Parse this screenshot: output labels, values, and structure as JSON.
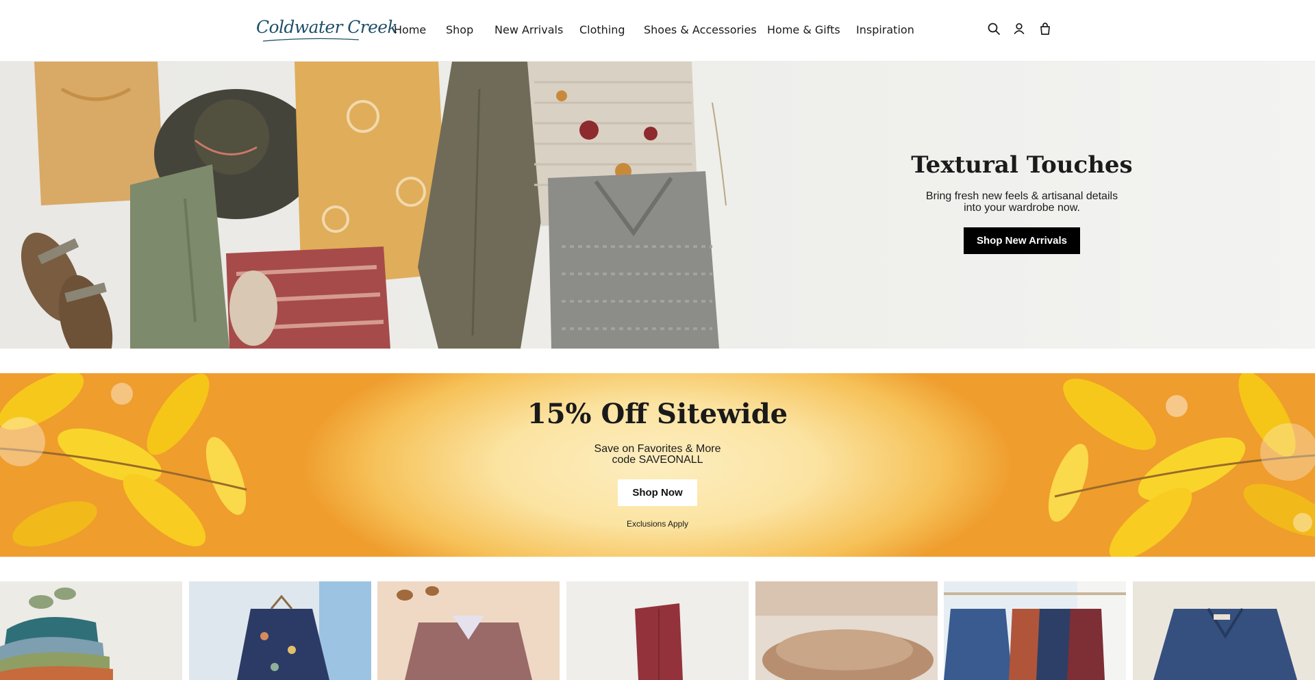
{
  "header": {
    "logo_text": "Coldwater Creek",
    "nav": [
      {
        "label": "Home"
      },
      {
        "label": "Shop"
      },
      {
        "label": "New Arrivals"
      },
      {
        "label": "Clothing"
      },
      {
        "label": "Shoes & Accessories"
      },
      {
        "label": "Home & Gifts"
      },
      {
        "label": "Inspiration"
      }
    ],
    "icons": [
      "search-icon",
      "account-icon",
      "shopping-bag-icon"
    ]
  },
  "hero": {
    "title": "Textural Touches",
    "subtitle_line1": "Bring fresh new feels & artisanal details",
    "subtitle_line2": "into your wardrobe now.",
    "button_label": "Shop New Arrivals"
  },
  "promo": {
    "title": "15% Off Sitewide",
    "line1": "Save on Favorites & More",
    "line2": "code SAVEONALL",
    "button_label": "Shop Now",
    "note": "Exclusions Apply"
  },
  "colors": {
    "logo": "#1f4f68",
    "button_dark": "#000000",
    "promo_orange": "#ef9d2d",
    "promo_yellow": "#fbe3a1"
  }
}
